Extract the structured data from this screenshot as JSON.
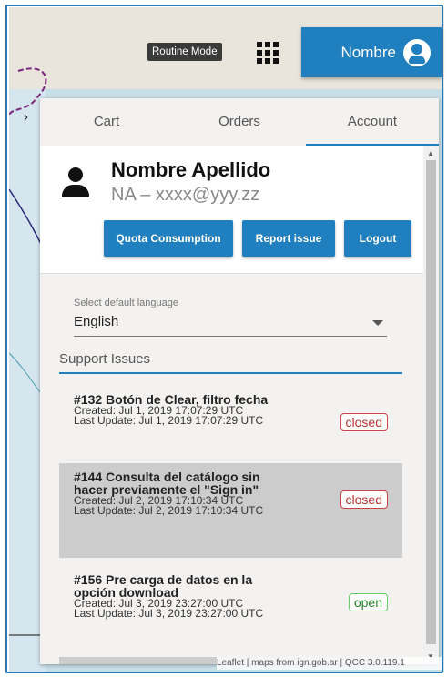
{
  "header": {
    "routine_mode": "Routine Mode",
    "user_label": "Nombre"
  },
  "icons": [
    "apps-grid-icon",
    "user-avatar-icon",
    "chevron-right-icon",
    "person-icon",
    "dropdown-caret-icon"
  ],
  "tabs": [
    {
      "label": "Cart",
      "active": false
    },
    {
      "label": "Orders",
      "active": false
    },
    {
      "label": "Account",
      "active": true
    }
  ],
  "account": {
    "name": "Nombre Apellido",
    "email": "NA – xxxx@yyy.zz",
    "buttons": {
      "quota": "Quota Consumption",
      "report": "Report issue",
      "logout": "Logout"
    }
  },
  "language": {
    "label": "Select default language",
    "value": "English"
  },
  "support": {
    "heading": "Support Issues",
    "issues": [
      {
        "title": "#132 Botón de Clear, filtro fecha",
        "created": "Created: Jul 1, 2019 17:07:29 UTC",
        "updated": "Last Update: Jul 1, 2019 17:07:29 UTC",
        "status": "closed"
      },
      {
        "title": "#144 Consulta del catálogo sin hacer previamente el \"Sign in\"",
        "created": "Created: Jul 2, 2019 17:10:34 UTC",
        "updated": "Last Update: Jul 2, 2019 17:10:34 UTC",
        "status": "closed"
      },
      {
        "title": "#156 Pre carga de datos en la opción download",
        "created": "Created: Jul 3, 2019 23:27:00 UTC",
        "updated": "Last Update: Jul 3, 2019 23:27:00 UTC",
        "status": "open"
      }
    ]
  },
  "attribution": "Leaflet | maps from ign.gob.ar | QCC 3.0.119.1",
  "colors": {
    "accent": "#1f7fbf",
    "closed": "#c44",
    "open": "#6c6"
  }
}
